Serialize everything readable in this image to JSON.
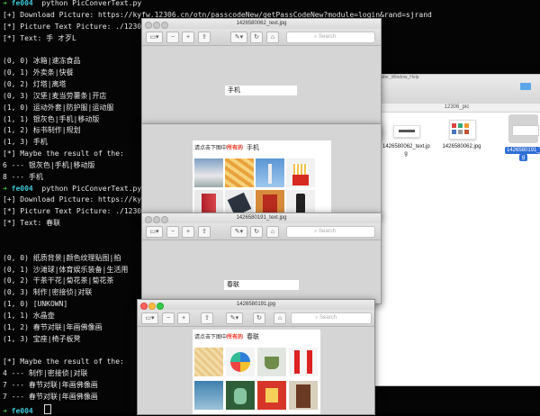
{
  "terminal": {
    "lines": [
      {
        "type": "prompt",
        "dir": "fe004",
        "cmd": "python PicConverText.py"
      },
      {
        "type": "text",
        "text": "[+] Download Picture: https://kyfw.12306.cn/otn/passcodeNew/getPassCodeNew?module=login&rand=sjrand"
      },
      {
        "type": "text",
        "text": "[*] Picture Text Picture: ./12306_"
      },
      {
        "type": "text",
        "text": "[*] Text: 手 オ歹L"
      },
      {
        "type": "text",
        "text": ""
      },
      {
        "type": "text",
        "text": "(0, 0) 冰箱|速冻食品"
      },
      {
        "type": "text",
        "text": "(0, 1) 外卖条|快餐"
      },
      {
        "type": "text",
        "text": "(0, 2) 灯塔|离塔"
      },
      {
        "type": "text",
        "text": "(0, 3) 汉堡|麦当劳薯条|开店"
      },
      {
        "type": "text",
        "text": "(1, 0) 运动外套|防护服|运动服"
      },
      {
        "type": "text",
        "text": "(1, 1) 银灰色|手机|移动版"
      },
      {
        "type": "text",
        "text": "(1, 2) 标书制作|规划"
      },
      {
        "type": "text",
        "text": "(1, 3) 手机"
      },
      {
        "type": "text",
        "text": "[*] Maybe the result of the:"
      },
      {
        "type": "text",
        "text": "6 --- 银灰色|手机|移动版"
      },
      {
        "type": "text",
        "text": "8 --- 手机"
      },
      {
        "type": "prompt",
        "dir": "fe004",
        "cmd": "python PicConverText.py"
      },
      {
        "type": "text",
        "text": "[+] Download Picture: https://ky"
      },
      {
        "type": "text",
        "text": "[*] Picture Text Picture: ./1230"
      },
      {
        "type": "text",
        "text": "[*] Text: 春联"
      },
      {
        "type": "text",
        "text": ""
      },
      {
        "type": "text",
        "text": ""
      },
      {
        "type": "text",
        "text": "(0, 0) 纸质背景|颜色纹理贴图|拍"
      },
      {
        "type": "text",
        "text": "(0, 1) 沙滩球|体育娱乐装备|生活用"
      },
      {
        "type": "text",
        "text": "(0, 2) 干茶干花|菊花茶|菊花茶"
      },
      {
        "type": "text",
        "text": "(0, 3) 制作|密接侦|对联"
      },
      {
        "type": "text",
        "text": "(1, 0) [UNKOWN]"
      },
      {
        "type": "text",
        "text": "(1, 1) 水晶壶"
      },
      {
        "type": "text",
        "text": "(1, 2) 春节对联|年画佛像画"
      },
      {
        "type": "text",
        "text": "(1, 3) 宝座|椅子板凳"
      },
      {
        "type": "text",
        "text": ""
      },
      {
        "type": "text",
        "text": "[*] Maybe the result of the:"
      },
      {
        "type": "text",
        "text": "4 --- 制作|密接侦|对联"
      },
      {
        "type": "text",
        "text": "7 --- 春节对联|年画佛像画"
      },
      {
        "type": "text",
        "text": "7 --- 春节对联|年画佛像画"
      },
      {
        "type": "prompt",
        "dir": "fe004",
        "cmd": "",
        "cursor": true
      }
    ]
  },
  "finder": {
    "menu_fragment": "lander_Window_Help",
    "folder_label": "12306_pic",
    "files": [
      {
        "name": "1426580062_text.jpg",
        "label_lines": [
          "1426580062_text.jp",
          "g"
        ],
        "selected": false
      },
      {
        "name": "1426580062.jpg",
        "label_lines": [
          "1426580062.jpg"
        ],
        "selected": false
      },
      {
        "name": "1426580191_text.jpg",
        "label_lines": [
          "1426580191_tex",
          "g"
        ],
        "selected": true
      }
    ]
  },
  "preview_windows": [
    {
      "title": "1426580062_text.jpg",
      "search_placeholder": "Search",
      "text_image": "手机",
      "active": false
    },
    {
      "title": "1426580062.jpg",
      "search_placeholder": "Search",
      "active": false,
      "captcha": {
        "instruction_prefix": "请点击下图中",
        "instruction_highlight": "所有的",
        "word": "手机"
      }
    },
    {
      "title": "1426580191_text.jpg",
      "search_placeholder": "Search",
      "text_image": "春联",
      "active": false
    },
    {
      "title": "1426580191.jpg",
      "search_placeholder": "Search",
      "active": true,
      "captcha": {
        "instruction_prefix": "请点击下图中",
        "instruction_highlight": "所有的",
        "word": "春联"
      }
    }
  ],
  "colors": {
    "terminal_bg": "#050505",
    "prompt_arrow": "#47d147",
    "prompt_dir": "#3fc5d6",
    "captcha_highlight": "#e32222",
    "traffic_red": "#fc615d",
    "traffic_yellow": "#fdbc40",
    "traffic_green": "#34c84a"
  }
}
